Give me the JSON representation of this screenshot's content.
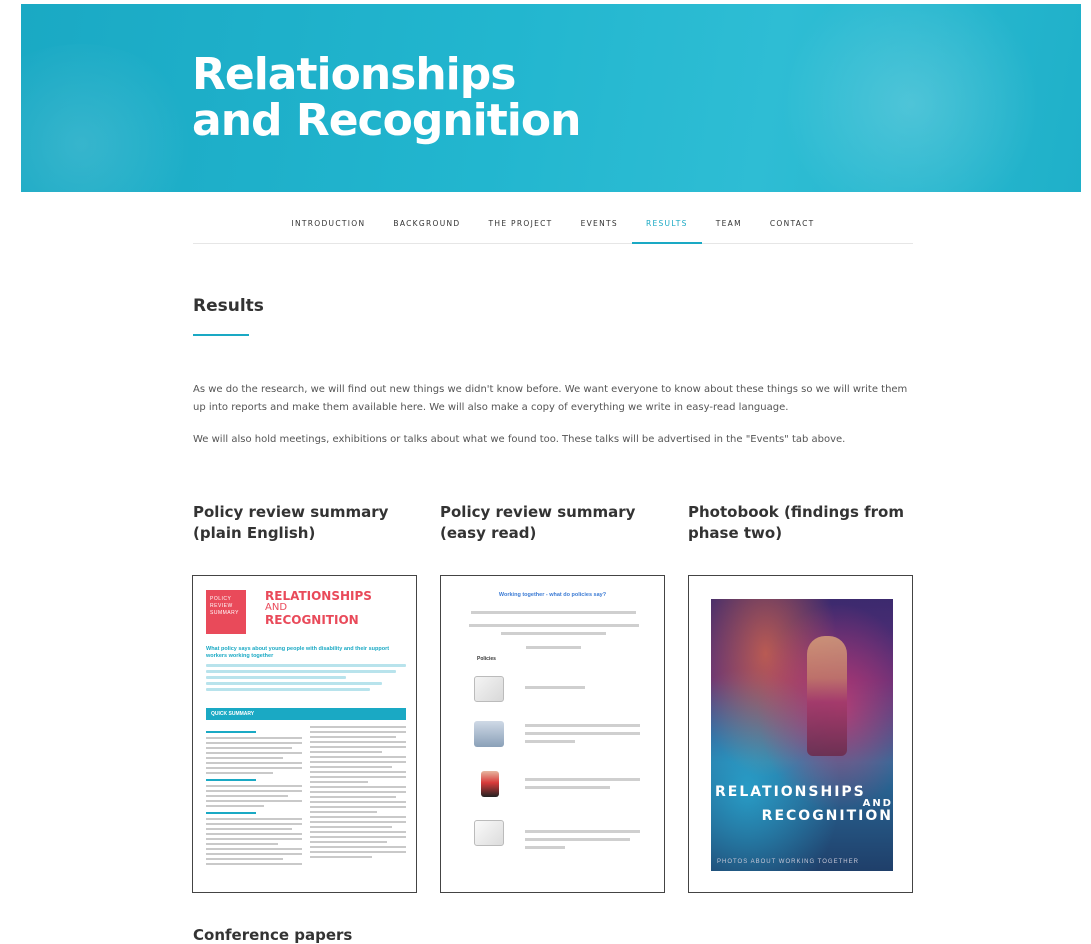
{
  "hero": {
    "title_line1": "Relationships",
    "title_line2": "and Recognition"
  },
  "nav": {
    "items": [
      "INTRODUCTION",
      "BACKGROUND",
      "THE PROJECT",
      "EVENTS",
      "RESULTS",
      "TEAM",
      "CONTACT"
    ],
    "active": "RESULTS"
  },
  "results": {
    "title": "Results",
    "para1": "As we do the research, we will find out new things we didn't know before. We want everyone to know about these things so we will write them up into reports and make them available here. We will also make a copy of everything we write in easy-read language.",
    "para2": "We will also hold meetings, exhibitions or talks about what we found too. These talks will be advertised in the \"Events\" tab above."
  },
  "cards": [
    {
      "title_line1": "Policy review summary",
      "title_line2": "(plain English)"
    },
    {
      "title_line1": "Policy review summary",
      "title_line2": "(easy read)"
    },
    {
      "title_line1": "Photobook (findings from",
      "title_line2": "phase two)"
    }
  ],
  "thumb1": {
    "tag": "POLICY REVIEW SUMMARY",
    "head1": "RELATIONSHIPS",
    "head2": "AND",
    "head3": "RECOGNITION",
    "question": "What policy says about young people with disability and their support workers working together",
    "bar": "QUICK SUMMARY"
  },
  "thumb2": {
    "heading": "Working together - what do policies say?",
    "section": "Policies"
  },
  "thumb3": {
    "word1": "RELATIONSHIPS",
    "word2": "AND",
    "word3": "RECOGNITION",
    "subtitle": "PHOTOS ABOUT WORKING TOGETHER"
  },
  "conference": {
    "title": "Conference papers"
  },
  "colors": {
    "accent": "#1aa9c4",
    "hero": "#22b6cf",
    "red": "#e94a5a"
  }
}
